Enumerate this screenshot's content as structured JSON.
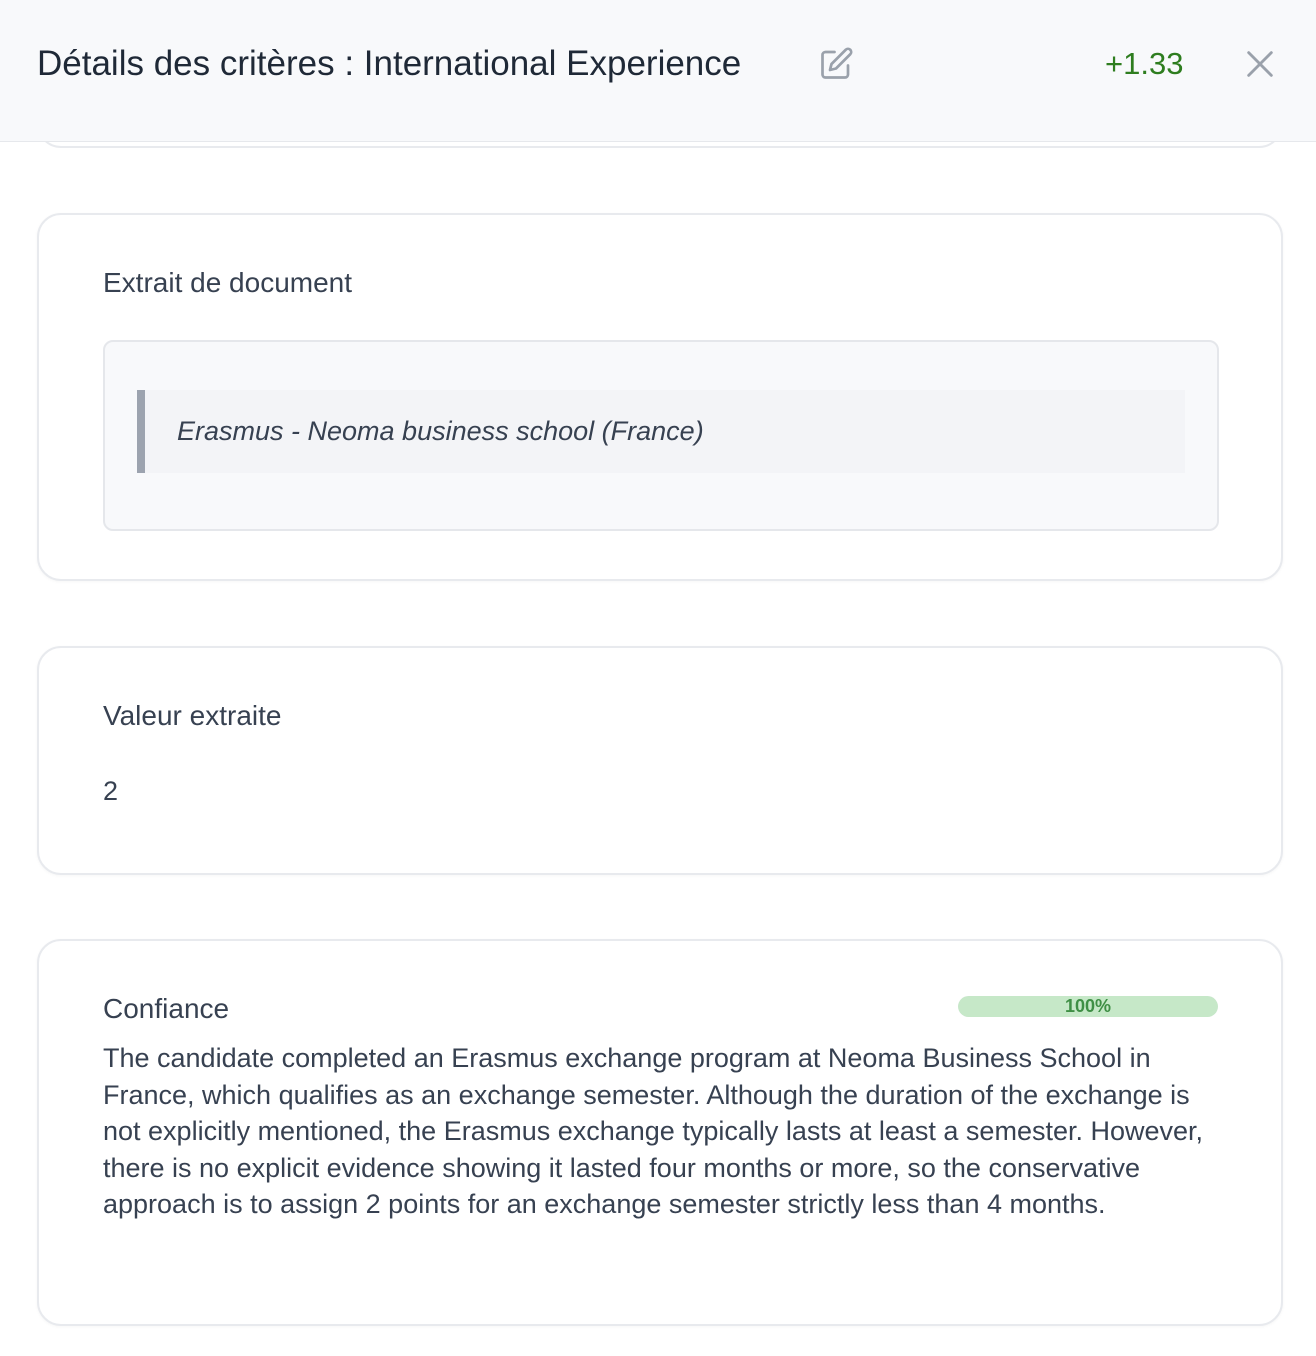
{
  "header": {
    "title": "Détails des critères : International Experience",
    "edit_icon": "edit-icon",
    "score": "+1.33",
    "close_icon": "close-icon"
  },
  "excerpt": {
    "title": "Extrait de document",
    "quote": "Erasmus - Neoma business school (France)"
  },
  "extracted_value": {
    "title": "Valeur extraite",
    "value": "2"
  },
  "confidence": {
    "title": "Confiance",
    "percent_label": "100%",
    "level": 1.0,
    "explanation": "The candidate completed an Erasmus exchange program at Neoma Business School in France, which qualifies as an exchange semester. Although the duration of the exchange is not explicitly mentioned, the Erasmus exchange typically lasts at least a semester. However, there is no explicit evidence showing it lasted four months or more, so the conservative approach is to assign 2 points for an exchange semester strictly less than 4 months."
  },
  "colors": {
    "score_green": "#2e7d1f",
    "progress_fill": "#c6e8c8",
    "progress_text": "#3f8f45"
  }
}
